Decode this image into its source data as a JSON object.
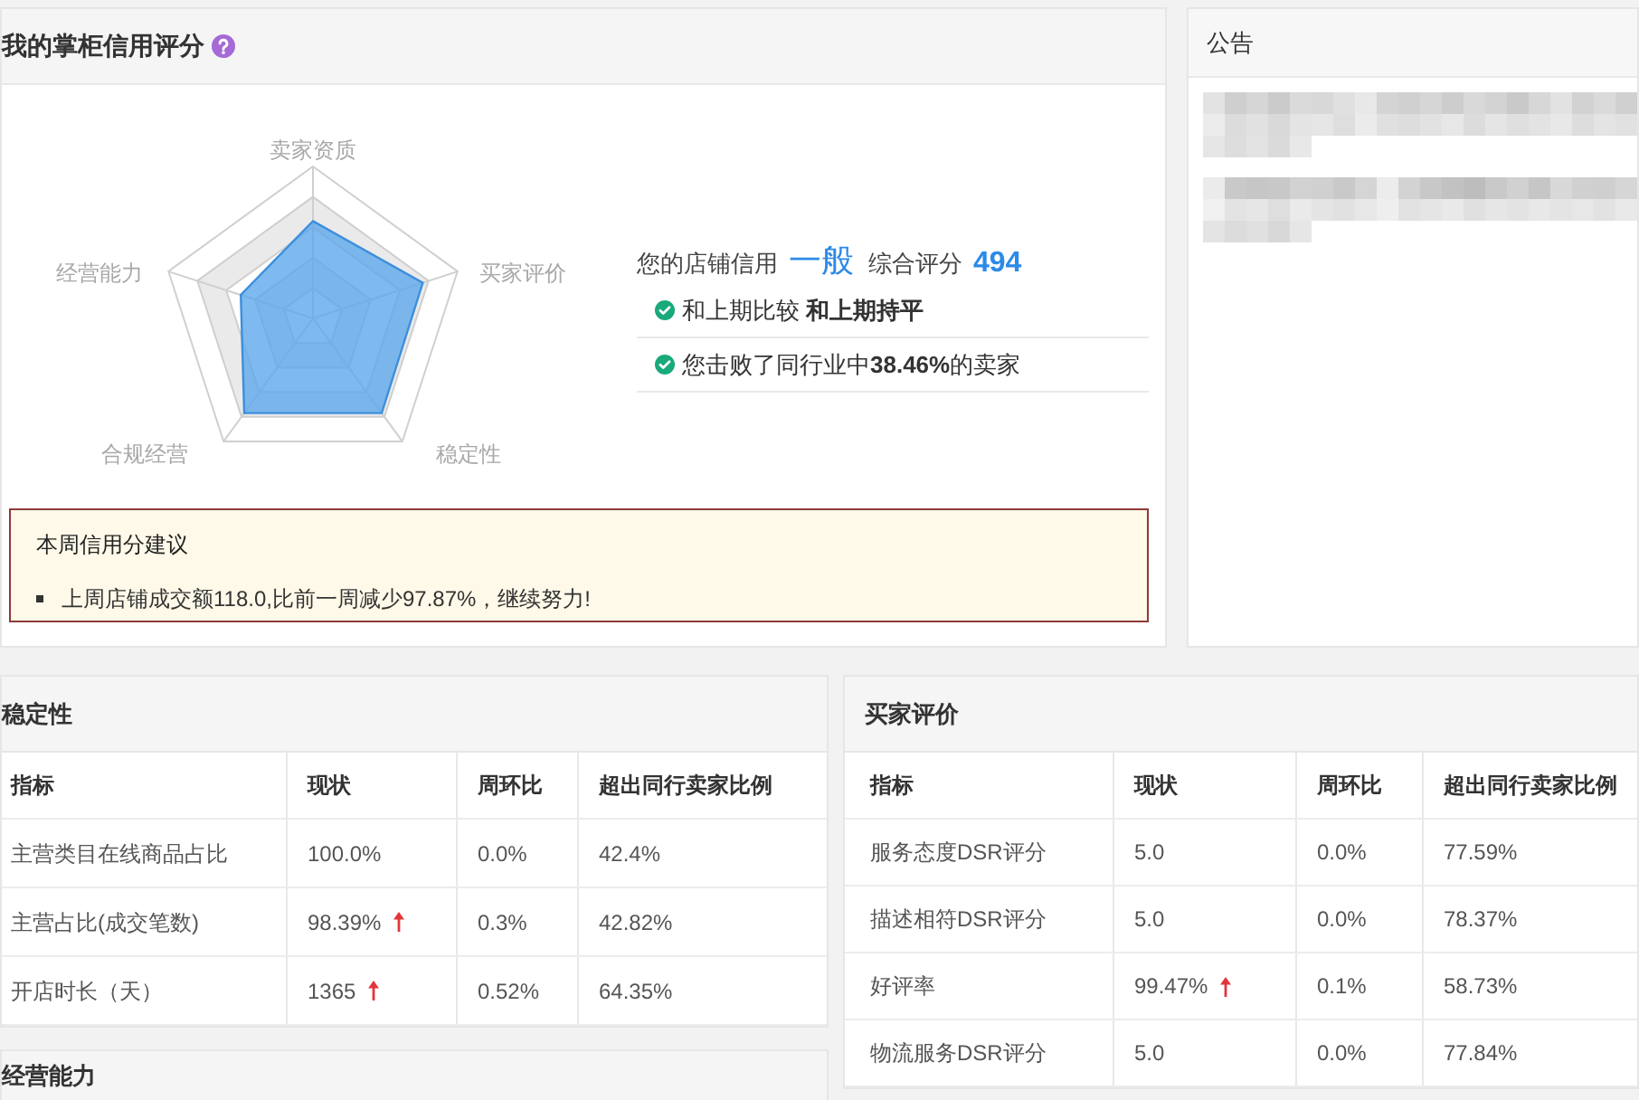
{
  "credit_panel": {
    "title": "我的掌柜信用评分",
    "radar_labels": [
      "卖家资质",
      "买家评价",
      "稳定性",
      "合规经营",
      "经营能力"
    ],
    "summary": {
      "label": "您的店铺信用",
      "level": "一般",
      "score_label": "综合评分",
      "score": "494"
    },
    "checks": [
      "和上期比较 **和上期持平**",
      "您击败了同行业中**38.46%**的卖家"
    ],
    "advice": {
      "title": "本周信用分建议",
      "items": [
        "上周店铺成交额118.0,比前一周减少97.87%，继续努力!"
      ]
    }
  },
  "notice_panel": {
    "title": "公告"
  },
  "tables": [
    {
      "title": "稳定性",
      "columns": [
        "指标",
        "现状",
        "周环比",
        "超出同行卖家比例"
      ],
      "rows": [
        {
          "cells": [
            "主营类目在线商品占比",
            "100.0%",
            "0.0%",
            "42.4%"
          ],
          "rising": false
        },
        {
          "cells": [
            "主营占比(成交笔数)",
            "98.39%",
            "0.3%",
            "42.82%"
          ],
          "rising": true
        },
        {
          "cells": [
            "开店时长（天）",
            "1365",
            "0.52%",
            "64.35%"
          ],
          "rising": true
        }
      ]
    },
    {
      "title": "买家评价",
      "columns": [
        "指标",
        "现状",
        "周环比",
        "超出同行卖家比例"
      ],
      "rows": [
        {
          "cells": [
            "服务态度DSR评分",
            "5.0",
            "0.0%",
            "77.59%"
          ],
          "rising": false
        },
        {
          "cells": [
            "描述相符DSR评分",
            "5.0",
            "0.0%",
            "78.37%"
          ],
          "rising": false
        },
        {
          "cells": [
            "好评率",
            "99.47%",
            "0.1%",
            "58.73%"
          ],
          "rising": true
        },
        {
          "cells": [
            "物流服务DSR评分",
            "5.0",
            "0.0%",
            "77.84%"
          ],
          "rising": false
        }
      ]
    }
  ],
  "next_section": {
    "title": "经营能力"
  }
}
